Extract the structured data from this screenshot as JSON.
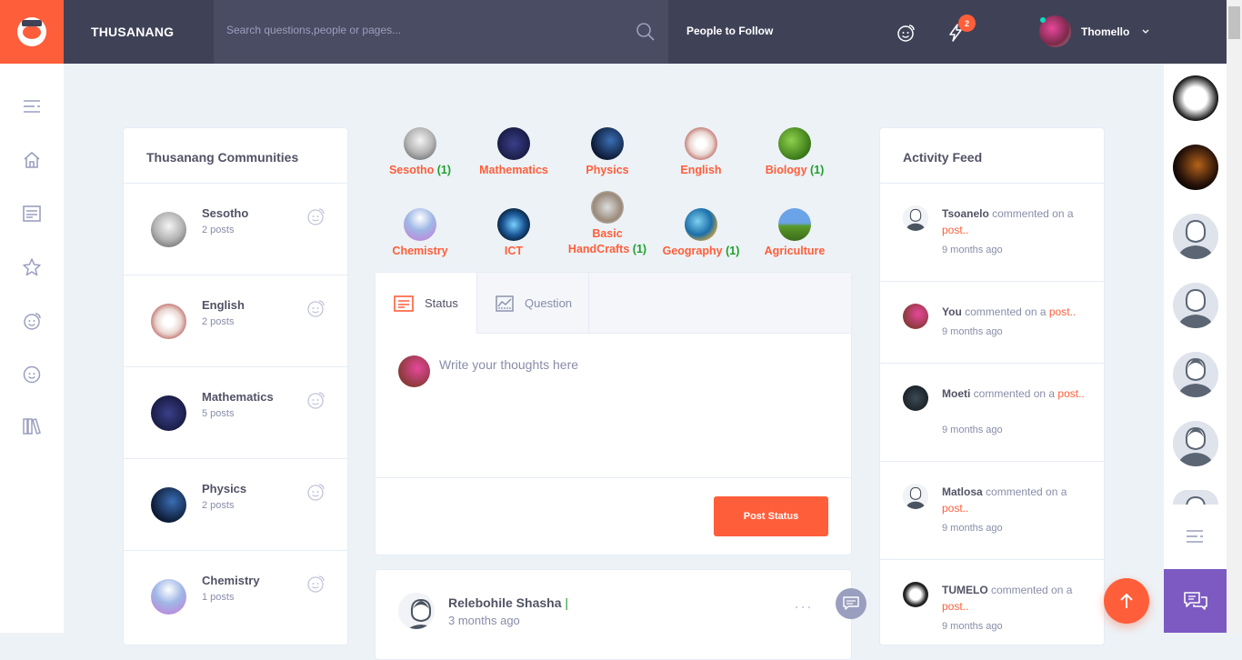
{
  "header": {
    "brand": "THUSANANG",
    "search_placeholder": "Search questions,people or pages...",
    "people_to_follow": "People to Follow",
    "notification_count": "2",
    "user_name": "Thomello"
  },
  "left_nav": {
    "icons": [
      "menu-icon",
      "home-icon",
      "newsfeed-icon",
      "star-icon",
      "happy-faces-icon",
      "smile-icon",
      "library-icon"
    ]
  },
  "communities": {
    "title": "Thusanang Communities",
    "items": [
      {
        "name": "Sesotho",
        "posts": "2 posts"
      },
      {
        "name": "English",
        "posts": "2 posts"
      },
      {
        "name": "Mathematics",
        "posts": "5 posts"
      },
      {
        "name": "Physics",
        "posts": "2 posts"
      },
      {
        "name": "Chemistry",
        "posts": "1 posts"
      }
    ]
  },
  "subjects": [
    {
      "name": "Sesotho",
      "count": "(1)"
    },
    {
      "name": "Mathematics",
      "count": ""
    },
    {
      "name": "Physics",
      "count": ""
    },
    {
      "name": "English",
      "count": ""
    },
    {
      "name": "Biology",
      "count": "(1)"
    },
    {
      "name": "Chemistry",
      "count": ""
    },
    {
      "name": "ICT",
      "count": ""
    },
    {
      "name": "Basic HandCrafts",
      "count": "(1)"
    },
    {
      "name": "Geography",
      "count": "(1)"
    },
    {
      "name": "Agriculture",
      "count": ""
    }
  ],
  "post_form": {
    "tab_status": "Status",
    "tab_question": "Question",
    "placeholder": "Write your thoughts here",
    "submit": "Post Status"
  },
  "post": {
    "author": "Relebohile Shasha",
    "separator": "|",
    "time": "3 months ago",
    "more": "···"
  },
  "activity": {
    "title": "Activity Feed",
    "items": [
      {
        "user": "Tsoanelo",
        "text": " commented on a ",
        "link": "post..",
        "time": "9 months ago"
      },
      {
        "user": "You",
        "text": " commented on a ",
        "link": "post..",
        "time": "9 months ago"
      },
      {
        "user": "Moeti",
        "text": " commented on a ",
        "link": "post..",
        "time": "9 months ago"
      },
      {
        "user": "Matlosa",
        "text": " commented on a ",
        "link": "post..",
        "time": "9 months ago"
      },
      {
        "user": "TUMELO",
        "text": " commented on a ",
        "link": "post..",
        "time": "9 months ago"
      }
    ]
  },
  "colors": {
    "accent": "#ff5e3a",
    "topbar": "#3f4257",
    "chat": "#7c5ac2",
    "count": "#1fa02c"
  }
}
